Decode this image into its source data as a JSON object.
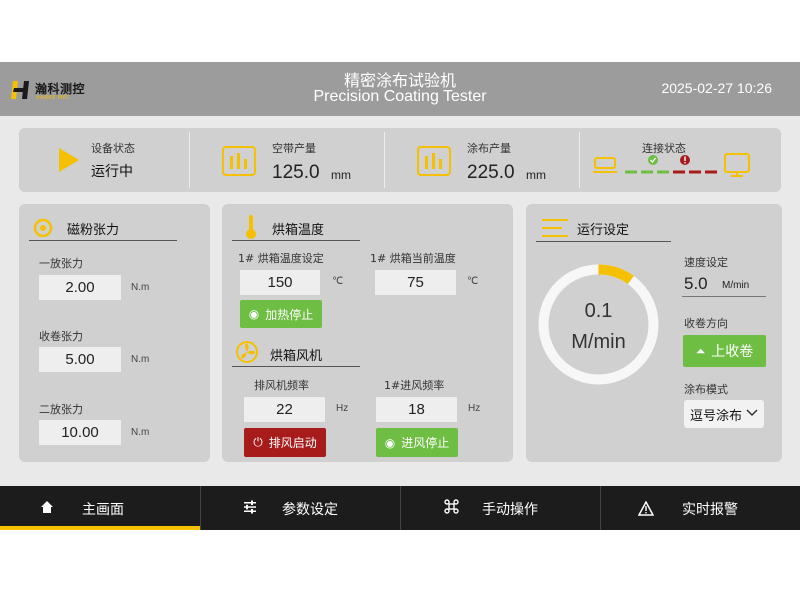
{
  "header": {
    "logo_text": "瀚科测控",
    "logo_sub": "HANKE MEC",
    "title_cn": "精密涂布试验机",
    "title_en": "Precision Coating Tester",
    "datetime": "2025-02-27 10:26"
  },
  "status": {
    "device_label": "设备状态",
    "device_value": "运行中",
    "empty_label": "空带产量",
    "empty_value": "125.0",
    "empty_unit": "mm",
    "coat_label": "涂布产量",
    "coat_value": "225.0",
    "coat_unit": "mm",
    "conn_label": "连接状态"
  },
  "tension": {
    "title": "磁粉张力",
    "unwind1_label": "一放张力",
    "unwind1_value": "2.00",
    "rewind_label": "收卷张力",
    "rewind_value": "5.00",
    "unwind2_label": "二放张力",
    "unwind2_value": "10.00",
    "unit": "N.m"
  },
  "oven": {
    "title": "烘箱温度",
    "set_label": "1# 烘箱温度设定",
    "set_value": "150",
    "cur_label": "1# 烘箱当前温度",
    "cur_value": "75",
    "unit": "℃",
    "heat_button": "加热停止"
  },
  "fan": {
    "title": "烘箱风机",
    "exhaust_label": "排风机频率",
    "exhaust_value": "22",
    "inlet_label": "1#进风频率",
    "inlet_value": "18",
    "unit": "Hz",
    "exhaust_button": "排风启动",
    "inlet_button": "进风停止"
  },
  "run": {
    "title": "运行设定",
    "gauge_value": "0.1",
    "gauge_unit": "M/min",
    "gauge_fraction": 0.1,
    "speed_label": "速度设定",
    "speed_value": "5.0",
    "speed_unit": "M/min",
    "direction_label": "收卷方向",
    "direction_button": "上收卷",
    "mode_label": "涂布模式",
    "mode_value": "逗号涂布"
  },
  "nav": {
    "home": "主画面",
    "params": "参数设定",
    "manual": "手动操作",
    "alarm": "实时报警"
  },
  "colors": {
    "accent": "#f5c000",
    "green": "#6fbe44",
    "red": "#a71b1b",
    "nav_bg": "#1c1c1c",
    "header_bg": "#9c9c9c"
  }
}
